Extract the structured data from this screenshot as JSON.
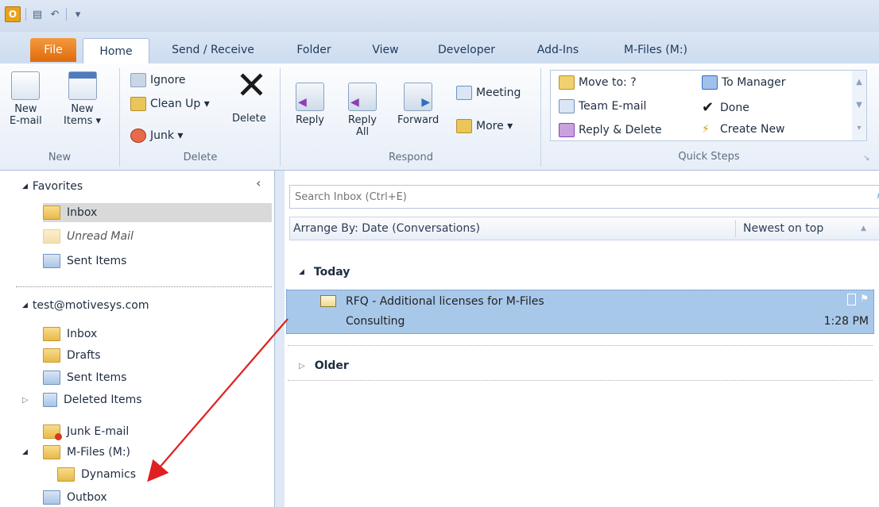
{
  "colors": {
    "file_tab": "#e06b0c",
    "selection": "#a8c8ea",
    "arrow": "#e02020"
  },
  "tabs": [
    "File",
    "Home",
    "Send / Receive",
    "Folder",
    "View",
    "Developer",
    "Add-Ins",
    "M-Files (M:)"
  ],
  "ribbon": {
    "new": {
      "new_email": [
        "New",
        "E-mail"
      ],
      "new_items": [
        "New",
        "Items ▾"
      ],
      "label": "New"
    },
    "delete": {
      "ignore": "Ignore",
      "cleanup": "Clean Up ▾",
      "junk": "Junk ▾",
      "delete": "Delete",
      "label": "Delete"
    },
    "respond": {
      "reply": "Reply",
      "reply_all": [
        "Reply",
        "All"
      ],
      "forward": "Forward",
      "meeting": "Meeting",
      "more": "More ▾",
      "label": "Respond"
    },
    "quicksteps": {
      "move_to": "Move to: ?",
      "team_email": "Team E-mail",
      "reply_delete": "Reply & Delete",
      "to_manager": "To Manager",
      "done": "Done",
      "create_new": "Create New",
      "label": "Quick Steps"
    }
  },
  "nav": {
    "collapse_glyph": "‹",
    "favorites_title": "Favorites",
    "favorites": [
      "Inbox",
      "Unread Mail",
      "Sent Items"
    ],
    "account": "test@motivesys.com",
    "folders": {
      "inbox": "Inbox",
      "drafts": "Drafts",
      "sent": "Sent Items",
      "deleted": "Deleted Items",
      "junk": "Junk E-mail",
      "mfiles": "M-Files (M:)",
      "dynamics": "Dynamics",
      "outbox": "Outbox"
    }
  },
  "list": {
    "search_placeholder": "Search Inbox (Ctrl+E)",
    "arrange_by": "Arrange By: Date (Conversations)",
    "sort_order": "Newest on top",
    "group_today": "Today",
    "group_older": "Older",
    "message": {
      "subject": "RFQ - Additional licenses for M-Files",
      "from": "Consulting",
      "time": "1:28 PM"
    }
  }
}
